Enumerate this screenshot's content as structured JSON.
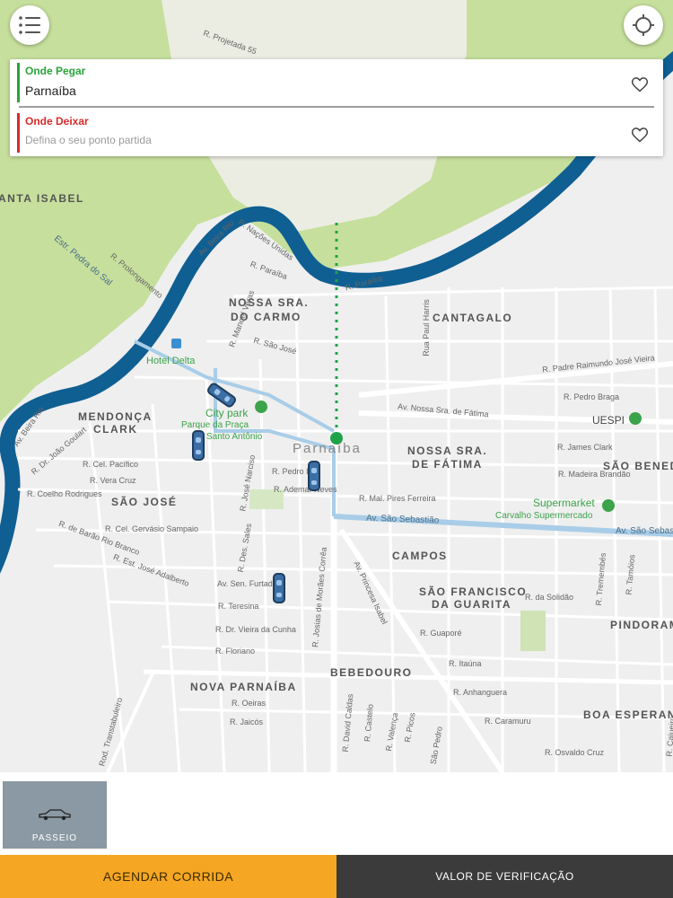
{
  "colors": {
    "pickup": "#2aa33a",
    "dropoff": "#d92b2b",
    "river": "#0f5f93",
    "accent_orange": "#f5a623"
  },
  "search": {
    "pickup_label": "Onde Pegar",
    "pickup_value": "Parnaíba",
    "dropoff_label": "Onde Deixar",
    "dropoff_placeholder": "Defina o seu ponto partida"
  },
  "map": {
    "neighborhoods": [
      "ANTA ISABEL",
      "NOSSA SRA.",
      "DO CARMO",
      "CANTAGALO",
      "MENDONÇA",
      "CLARK",
      "NOSSA SRA.",
      "DE FÁTIMA",
      "SÃO BENEDI",
      "SÃO JOSÉ",
      "CAMPOS",
      "SÃO FRANCISCO",
      "DA GUARITA",
      "PINDORAM",
      "BEBEDOURO",
      "NOVA PARNAÍBA",
      "BOA ESPERANÇ"
    ],
    "city": "Parnaíba",
    "streets": [
      "R. Projetada 55",
      "R. Nações Unidas",
      "R. Paraíba",
      "R. Paraíba",
      "Estr. Pedra do Sal",
      "R. Prolongamento",
      "R. Manoel Veras",
      "R. São José",
      "R. Padre Raimundo José Vieira",
      "Rua Paul Harris",
      "R. Pedro Braga",
      "Av. Nossa Sra. de Fátima",
      "Av. Beira Rio",
      "Av. Beira Rio",
      "R. Dr. João Goulart",
      "R. Cel. Pacífico",
      "R. Vera Cruz",
      "R. Coelho Rodrigues",
      "R. José Narciso",
      "R. Pedro II",
      "R. Ademar Neves",
      "R. James Clark",
      "R. Madeira Brandão",
      "R. Mal. Pires Ferreira",
      "Av. São Sebastião",
      "Av. São Sebastião",
      "R. Cel. Gervásio Sampaio",
      "R. de Barão Rio Branco",
      "R. Est. José Adalberto",
      "R. Des. Sales",
      "Av. Sen. Furtado",
      "R. Teresina",
      "R. Dr. Vieira da Cunha",
      "R. Floriano",
      "R. Josias de Morães Corrêa",
      "Av. Princesa Isabel",
      "R. da Solidão",
      "R. Tremembés",
      "R. Tamóios",
      "R. Guaporé",
      "R. Itaúna",
      "R. Anhanguera",
      "R. Caramuru",
      "R. Osvaldo Cruz",
      "R. Oeiras",
      "R. Jaicós",
      "Rod. Transtabuleiro",
      "R. David Caldas",
      "R. Castelo",
      "R. Valença",
      "R. Picos",
      "São Pedro",
      "R. Cajueiro"
    ],
    "places": [
      "Hotel Delta",
      "City park",
      "Parque da Praça",
      "Santo Antônio",
      "UESPI",
      "Supermarket",
      "Carvalho Supermercado"
    ],
    "icons": [
      "menu-icon",
      "crosshair-icon",
      "heart-icon",
      "car-icon",
      "bus-stop-icon",
      "park-pin-icon"
    ]
  },
  "service": {
    "label": "PASSEIO"
  },
  "actions": {
    "schedule": "AGENDAR CORRIDA",
    "check_price": "VALOR DE VERIFICAÇÃO"
  }
}
